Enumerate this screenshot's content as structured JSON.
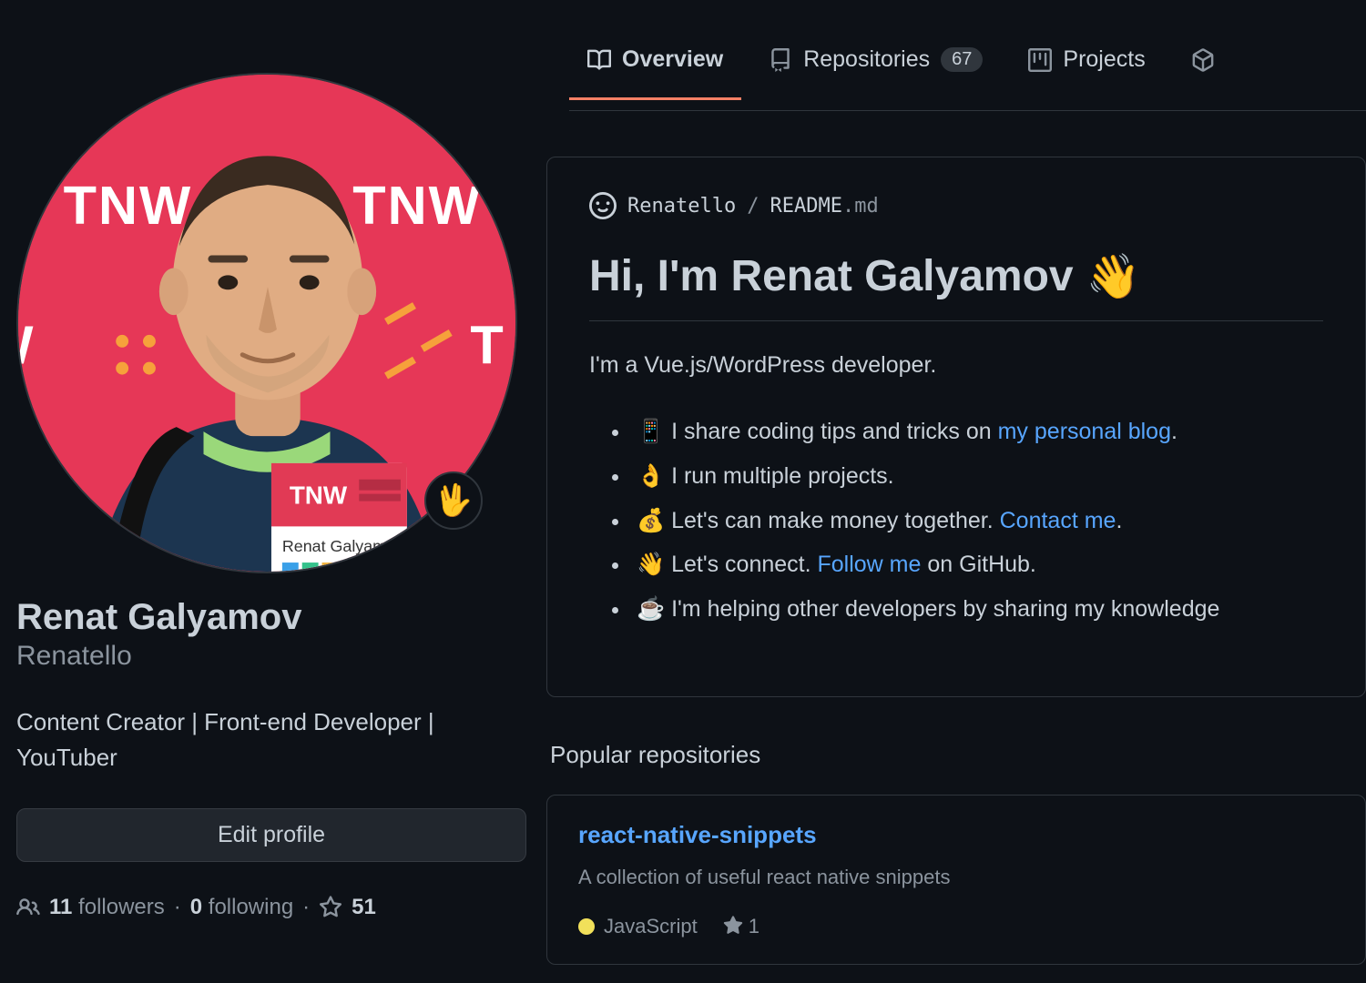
{
  "tabs": {
    "overview": "Overview",
    "repositories": "Repositories",
    "repo_count": "67",
    "projects": "Projects"
  },
  "profile": {
    "status_emoji": "🖖",
    "fullname": "Renat Galyamov",
    "username": "Renatello",
    "bio": "Content Creator | Front-end Developer | YouTuber",
    "edit_label": "Edit profile",
    "followers_count": "11",
    "followers_label": "followers",
    "following_count": "0",
    "following_label": "following",
    "stars_count": "51"
  },
  "readme": {
    "path_user": "Renatello",
    "path_sep": "/",
    "path_file": "README",
    "path_ext": ".md",
    "heading": "Hi, I'm Renat Galyamov",
    "heading_emoji": "👋",
    "intro": "I'm a Vue.js/WordPress developer.",
    "items": [
      {
        "emoji": "📱",
        "before": "I share coding tips and tricks on ",
        "link": "my personal blog",
        "after": "."
      },
      {
        "emoji": "👌",
        "before": "I run multiple projects.",
        "link": "",
        "after": ""
      },
      {
        "emoji": "💰",
        "before": "Let's can make money together. ",
        "link": "Contact me",
        "after": "."
      },
      {
        "emoji": "👋",
        "before": "Let's connect. ",
        "link": "Follow me",
        "after": " on GitHub."
      },
      {
        "emoji": "☕",
        "before": "I'm helping other developers by sharing my knowledge",
        "link": "",
        "after": ""
      }
    ]
  },
  "popular": {
    "heading": "Popular repositories",
    "repo": {
      "name": "react-native-snippets",
      "desc": "A collection of useful react native snippets",
      "lang": "JavaScript",
      "lang_color": "#f1e05a",
      "stars": "1"
    }
  }
}
